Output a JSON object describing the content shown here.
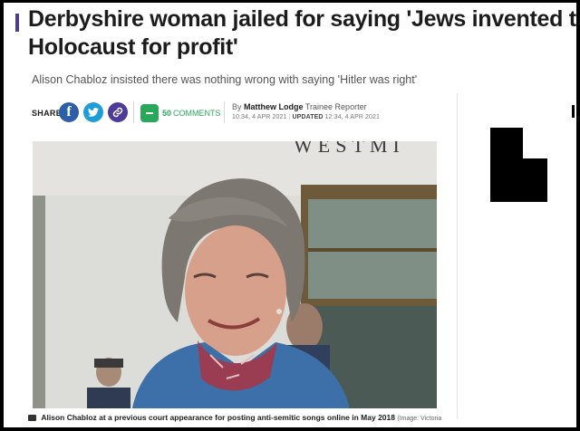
{
  "article": {
    "headline_line1": "Derbyshire woman jailed for saying 'Jews invented the",
    "headline_line2": "Holocaust for profit'",
    "subheadline": "Alison Chabloz insisted there was nothing wrong with saying 'Hitler was right'"
  },
  "share": {
    "label": "SHARE",
    "facebook_glyph": "f",
    "twitter_glyph": "🐦",
    "link_glyph": "🔗"
  },
  "comments": {
    "count": "50",
    "label": "COMMENTS",
    "color": "#2aa85a"
  },
  "byline": {
    "by": "By",
    "author": "Matthew Lodge",
    "role": "Trainee Reporter",
    "published": "10:34, 4 APR 2021",
    "updated_label": "UPDATED",
    "updated": "12:34, 4 APR 2021"
  },
  "hero_image": {
    "building_sign": "WESTMI",
    "caption": "Alison Chabloz at a previous court appearance for posting anti-semitic songs online in May 2018",
    "credit": "(Image: Victoria Jones/PA Wire)"
  },
  "colors": {
    "accent": "#4d3a99",
    "facebook": "#2b5fa6",
    "twitter": "#1e9ed9",
    "text": "#1c1c1c"
  }
}
